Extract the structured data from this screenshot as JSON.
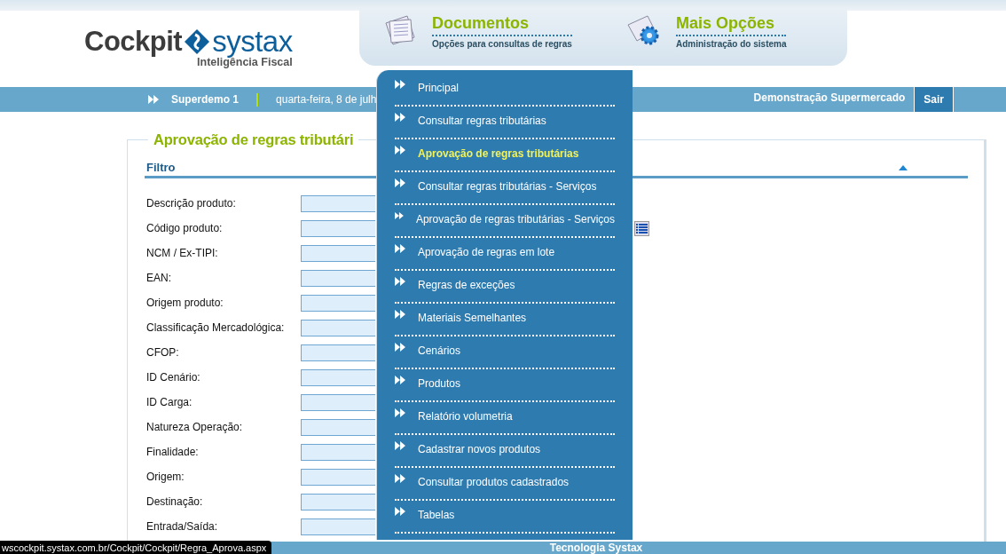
{
  "logo": {
    "word_1": "Cockpit",
    "word_2": "systax",
    "tagline": "Inteligência Fiscal"
  },
  "nav": [
    {
      "title": "Documentos",
      "subtitle": "Opções para consultas de regras",
      "kind": "documents"
    },
    {
      "title": "Mais Opções",
      "subtitle": "Administração do sistema",
      "kind": "gear"
    }
  ],
  "user_bar": {
    "user": "Superdemo 1",
    "date": "quarta-feira, 8 de julh",
    "company": "Demonstração Supermercado",
    "logout": "Sair"
  },
  "page_title": "Aprovação de regras tributári",
  "filter": {
    "title": "Filtro",
    "expanded": true,
    "fields": [
      {
        "label": "Descrição produto:",
        "kind": "text"
      },
      {
        "label": "Código produto:",
        "kind": "list"
      },
      {
        "label": "NCM / Ex-TIPI:",
        "kind": "text"
      },
      {
        "label": "EAN:",
        "kind": "text"
      },
      {
        "label": "Origem produto:",
        "kind": "text"
      },
      {
        "label": "Classificação Mercadológica:",
        "kind": "text"
      },
      {
        "label": "CFOP:",
        "kind": "text"
      },
      {
        "label": "ID Cenário:",
        "kind": "text"
      },
      {
        "label": "ID Carga:",
        "kind": "text"
      },
      {
        "label": "Natureza Operação:",
        "kind": "text"
      },
      {
        "label": "Finalidade:",
        "kind": "text"
      },
      {
        "label": "Origem:",
        "kind": "text"
      },
      {
        "label": "Destinação:",
        "kind": "text"
      },
      {
        "label": "Entrada/Saída:",
        "kind": "text"
      }
    ]
  },
  "menu": [
    {
      "label": "Principal",
      "selected": false
    },
    {
      "label": "Consultar regras tributárias",
      "selected": false
    },
    {
      "label": "Aprovação de regras tributárias",
      "selected": true
    },
    {
      "label": "Consultar regras tributárias - Serviços",
      "selected": false
    },
    {
      "label": "Aprovação de regras tributárias - Serviços",
      "selected": false
    },
    {
      "label": "Aprovação de regras em lote",
      "selected": false
    },
    {
      "label": "Regras de exceções",
      "selected": false
    },
    {
      "label": "Materiais Semelhantes",
      "selected": false
    },
    {
      "label": "Cenários",
      "selected": false
    },
    {
      "label": "Produtos",
      "selected": false
    },
    {
      "label": "Relatório volumetria",
      "selected": false
    },
    {
      "label": "Cadastrar novos produtos",
      "selected": false
    },
    {
      "label": "Consultar produtos cadastrados",
      "selected": false
    },
    {
      "label": "Tabelas",
      "selected": false
    }
  ],
  "footer": "Tecnologia Systax",
  "status_url": "wscockpit.systax.com.br/Cockpit/Cockpit/Regra_Aprova.aspx"
}
